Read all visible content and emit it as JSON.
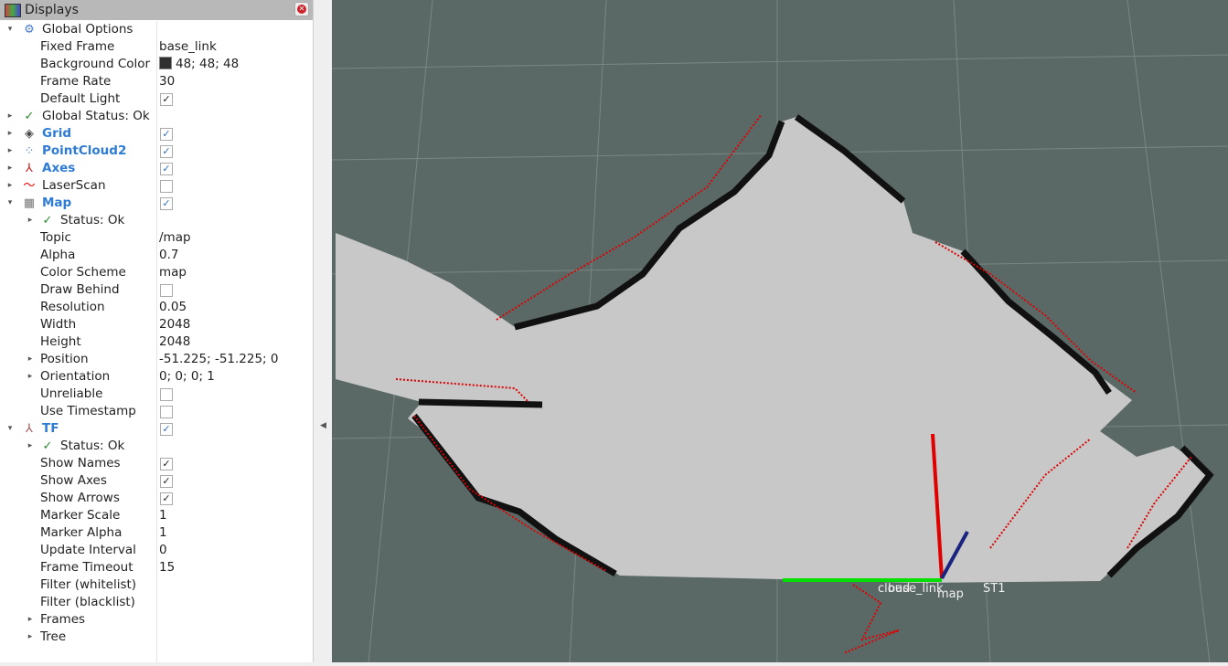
{
  "panel": {
    "title": "Displays",
    "icon": "monitor-icon",
    "close_icon": "close-icon"
  },
  "rows": [
    {
      "label": "Global Options",
      "level": 0,
      "exp": "open",
      "icon": "gear-icon"
    },
    {
      "label": "Fixed Frame",
      "level": 1,
      "value": "base_link"
    },
    {
      "label": "Background Color",
      "level": 1,
      "value": "48; 48; 48",
      "swatch": "#303030"
    },
    {
      "label": "Frame Rate",
      "level": 1,
      "value": "30"
    },
    {
      "label": "Default Light",
      "level": 1,
      "check": true
    },
    {
      "label": "Global Status: Ok",
      "level": 0,
      "exp": "closed",
      "icon": "checkmark-icon"
    },
    {
      "label": "Grid",
      "level": 0,
      "exp": "closed",
      "icon": "grid-icon",
      "check": true,
      "bold": true
    },
    {
      "label": "PointCloud2",
      "level": 0,
      "exp": "closed",
      "icon": "pointcloud-icon",
      "check": true,
      "bold": true
    },
    {
      "label": "Axes",
      "level": 0,
      "exp": "closed",
      "icon": "axes-icon",
      "check": true,
      "bold": true
    },
    {
      "label": "LaserScan",
      "level": 0,
      "exp": "closed",
      "icon": "laserscan-icon",
      "check": false
    },
    {
      "label": "Map",
      "level": 0,
      "exp": "open",
      "icon": "map-icon",
      "check": true,
      "bold": true
    },
    {
      "label": "Status: Ok",
      "level": 2,
      "exp": "closed",
      "icon": "checkmark-icon"
    },
    {
      "label": "Topic",
      "level": 1,
      "value": "/map"
    },
    {
      "label": "Alpha",
      "level": 1,
      "value": "0.7"
    },
    {
      "label": "Color Scheme",
      "level": 1,
      "value": "map"
    },
    {
      "label": "Draw Behind",
      "level": 1,
      "check": false
    },
    {
      "label": "Resolution",
      "level": 1,
      "value": "0.05"
    },
    {
      "label": "Width",
      "level": 1,
      "value": "2048"
    },
    {
      "label": "Height",
      "level": 1,
      "value": "2048"
    },
    {
      "label": "Position",
      "level": 1,
      "exp": "closed",
      "value": "-51.225; -51.225; 0"
    },
    {
      "label": "Orientation",
      "level": 1,
      "exp": "closed",
      "value": "0; 0; 0; 1"
    },
    {
      "label": "Unreliable",
      "level": 1,
      "check": false
    },
    {
      "label": "Use Timestamp",
      "level": 1,
      "check": false
    },
    {
      "label": "TF",
      "level": 0,
      "exp": "open",
      "icon": "tf-icon",
      "check": true,
      "bold": true
    },
    {
      "label": "Status: Ok",
      "level": 2,
      "exp": "closed",
      "icon": "checkmark-icon"
    },
    {
      "label": "Show Names",
      "level": 1,
      "check": true
    },
    {
      "label": "Show Axes",
      "level": 1,
      "check": true
    },
    {
      "label": "Show Arrows",
      "level": 1,
      "check": true
    },
    {
      "label": "Marker Scale",
      "level": 1,
      "value": "1"
    },
    {
      "label": "Marker Alpha",
      "level": 1,
      "value": "1"
    },
    {
      "label": "Update Interval",
      "level": 1,
      "value": "0"
    },
    {
      "label": "Frame Timeout",
      "level": 1,
      "value": "15"
    },
    {
      "label": "Filter (whitelist)",
      "level": 1
    },
    {
      "label": "Filter (blacklist)",
      "level": 1
    },
    {
      "label": "Frames",
      "level": 1,
      "exp": "closed"
    },
    {
      "label": "Tree",
      "level": 1,
      "exp": "closed"
    }
  ],
  "viewport": {
    "background": "#5b6966",
    "map_free": "#c8c8c8",
    "laser": "#e00000",
    "frame_labels": [
      "cloud",
      "base_link",
      "map",
      "ST1"
    ]
  }
}
